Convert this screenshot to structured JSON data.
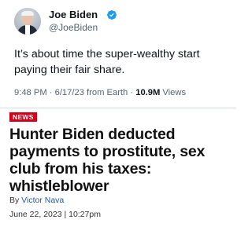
{
  "tweet": {
    "author_name": "Joe Biden",
    "author_handle": "@JoeBiden",
    "verified_icon": "verified-badge-icon",
    "text": "It’s about time the super-wealthy start paying their fair share.",
    "time": "9:48 PM · 6/17/23 from Earth · ",
    "views_count": "10.9M",
    "views_label": " Views",
    "colors": {
      "verified": "#1d9bf0",
      "secondary_text": "#536471"
    }
  },
  "article": {
    "section_badge": "NEWS",
    "headline": "Hunter Biden deducted payments to prostitute, sex club from his taxes: whistleblower",
    "byline_prefix": "By ",
    "author": "Victor Nava",
    "date": "June 22, 2023 | 10:27pm",
    "colors": {
      "badge": "#d0021b",
      "author_link": "#1f5aa6"
    }
  }
}
